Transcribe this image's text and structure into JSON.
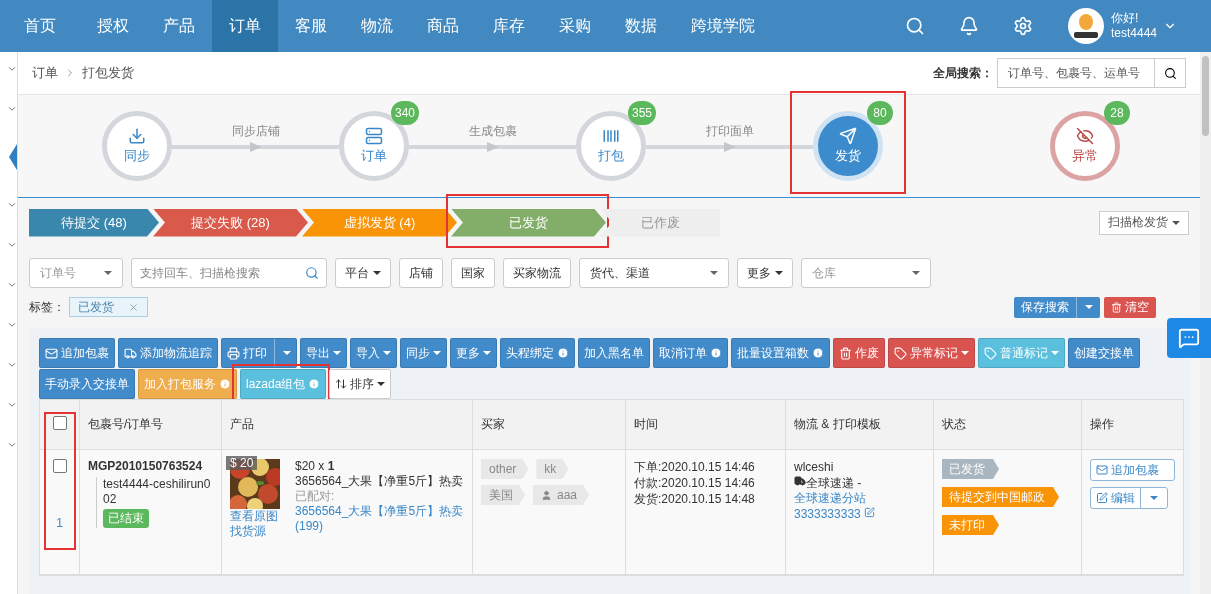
{
  "nav": {
    "items": [
      {
        "label": "首页",
        "selected": false
      },
      {
        "label": "授权",
        "selected": false
      },
      {
        "label": "产品",
        "selected": false
      },
      {
        "label": "订单",
        "selected": true
      },
      {
        "label": "客服",
        "selected": false
      },
      {
        "label": "物流",
        "selected": false
      },
      {
        "label": "商品",
        "selected": false
      },
      {
        "label": "库存",
        "selected": false
      },
      {
        "label": "采购",
        "selected": false
      },
      {
        "label": "数据",
        "selected": false
      },
      {
        "label": "跨境学院",
        "selected": false
      }
    ],
    "user": {
      "greeting": "你好!",
      "name": "test4444"
    }
  },
  "breadcrumb": [
    "订单",
    "打包发货"
  ],
  "global_search": {
    "label": "全局搜索：",
    "placeholder": "订单号、包裹号、运单号"
  },
  "steps": [
    {
      "label": "同步",
      "kind": "sync",
      "selected": false,
      "highlighted": false
    },
    {
      "label": "订单",
      "kind": "list",
      "badge": "340",
      "selected": false,
      "highlighted": false
    },
    {
      "label": "打包",
      "kind": "barcode",
      "badge": "355",
      "selected": false,
      "highlighted": false
    },
    {
      "label": "发货",
      "kind": "send",
      "badge": "80",
      "selected": true,
      "highlighted": true
    },
    {
      "label": "异常",
      "kind": "alert",
      "badge": "28",
      "selected": false,
      "highlighted": false
    }
  ],
  "connectors": [
    "同步店铺",
    "生成包裹",
    "打印面单"
  ],
  "status_tabs": [
    {
      "label": "待提交 (48)",
      "color": "#3a87ad",
      "highlighted": false
    },
    {
      "label": "提交失败 (28)",
      "color": "#d9594a",
      "highlighted": false
    },
    {
      "label": "虚拟发货 (4)",
      "color": "#f89406",
      "highlighted": false
    },
    {
      "label": "已发货",
      "color": "#82ae6a",
      "highlighted": true
    },
    {
      "label": "已作废",
      "color": "#eeeeee",
      "highlighted": false
    }
  ],
  "scan_button": "扫描枪发货",
  "filters": [
    {
      "kind": "select",
      "placeholder": "订单号"
    },
    {
      "kind": "search",
      "placeholder": "支持回车、扫描枪搜索"
    },
    {
      "kind": "dropdown",
      "label": "平台"
    },
    {
      "kind": "button",
      "label": "店铺"
    },
    {
      "kind": "button",
      "label": "国家"
    },
    {
      "kind": "button",
      "label": "买家物流"
    },
    {
      "kind": "select",
      "value": "货代、渠道"
    },
    {
      "kind": "dropdown",
      "label": "更多"
    },
    {
      "kind": "select",
      "placeholder": "仓库"
    }
  ],
  "tags": {
    "label": "标签：",
    "items": [
      "已发货"
    ]
  },
  "save_search": "保存搜索",
  "clear_button": "清空",
  "toolbar": [
    {
      "label": "追加包裹",
      "color": "#428bca"
    },
    {
      "label": "添加物流追踪",
      "color": "#428bca"
    },
    {
      "label": "打印",
      "color": "#428bca"
    },
    {
      "label": "导出",
      "color": "#428bca"
    },
    {
      "label": "导入",
      "color": "#428bca"
    },
    {
      "label": "同步",
      "color": "#428bca"
    },
    {
      "label": "更多",
      "color": "#428bca"
    },
    {
      "label": "头程绑定",
      "color": "#428bca",
      "info": true
    },
    {
      "label": "加入黑名单",
      "color": "#428bca",
      "info": false
    },
    {
      "label": "取消订单",
      "color": "#428bca",
      "info": true
    },
    {
      "label": "批量设置箱数",
      "color": "#428bca",
      "info": true
    },
    {
      "label": "作废",
      "color": "#d9534f"
    },
    {
      "label": "异常标记",
      "color": "#d9534f"
    },
    {
      "label": "普通标记",
      "color": "#5bc0de"
    },
    {
      "label": "创建交接单",
      "color": "#428bca",
      "info": false
    },
    {
      "label": "手动录入交接单",
      "color": "#428bca",
      "info": false
    },
    {
      "label": "加入打包服务",
      "color": "#f0ad4e",
      "info": true
    },
    {
      "label": "lazada组包",
      "color": "#5bc0de",
      "info": true,
      "highlighted": true
    },
    {
      "label": "排序",
      "color": "#ffffff"
    }
  ],
  "table": {
    "columns": [
      "包裹号/订单号",
      "产品",
      "买家",
      "时间",
      "物流 & 打印模板",
      "状态",
      "操作"
    ],
    "header_checked": false,
    "checkbox_column_highlighted": true,
    "rows": [
      {
        "checked": false,
        "index": "1",
        "package_no": "MGP2010150763524",
        "order_no": "test4444-ceshilirun002",
        "order_status": "已结束",
        "product": {
          "kind": "picture",
          "price_tag": "$ 20",
          "price": "$20 x **1**",
          "name": "3656564_大果【净重5斤】热卖",
          "links": [
            "查看原图",
            "找货源"
          ],
          "matched_label": "已配对: ",
          "matched": "3656564_大果【净重5斤】热卖 (199)"
        },
        "buyer": [
          {
            "label": "other",
            "kind": "plain"
          },
          {
            "label": "kk",
            "kind": "plain"
          },
          {
            "label": "美国",
            "kind": "plain"
          },
          {
            "label": "aaa",
            "kind": "user"
          }
        ],
        "times": [
          "下单:2020.10.15 14:46",
          "付款:2020.10.15 14:46",
          "发货:2020.10.15 14:48"
        ],
        "logistics": {
          "name": "wlceshi",
          "carrier": "全球速递 - ",
          "station": "全球速递分站",
          "tracking": "3333333333"
        },
        "statuses": [
          {
            "label": "已发货",
            "color": "#aab6bf"
          },
          {
            "label": "待提交到中国邮政",
            "color": "#f89406"
          },
          {
            "label": "未打印",
            "color": "#f89406"
          }
        ],
        "actions": [
          "追加包裹",
          "编辑"
        ]
      }
    ]
  }
}
